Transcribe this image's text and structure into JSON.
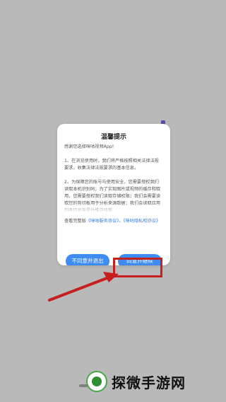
{
  "dialog": {
    "title": "温馨提示",
    "paragraph_1": "感谢您选择咪咕视频App!",
    "paragraph_2": "1、在浏览使用时，我们将严格按照相关法律法规要求，收集法律法规要求的基本信息。",
    "paragraph_3": "2、为保障您的账号与使用安全，您需要授权我们读取本机识别码；为了实现图片或视频的缓存和取用，您需要授权我们读取存储权限；我们会需要读取您的剪切板用于分析来源数据；我们会读取应用列表信息来提升推送效能。",
    "agree_prefix": "查看完整版",
    "service_link": "《咪咕服务协议》",
    "separator": "、",
    "privacy_link": "《咪咕隐私权协议》",
    "btn_disagree": "不同意并退出",
    "btn_agree": "同意并继续"
  },
  "watermark": {
    "text": "探微手游网"
  },
  "colors": {
    "accent": "#3e8cf2",
    "highlight": "#c51f1f",
    "overlay": "#b9b9b9"
  }
}
